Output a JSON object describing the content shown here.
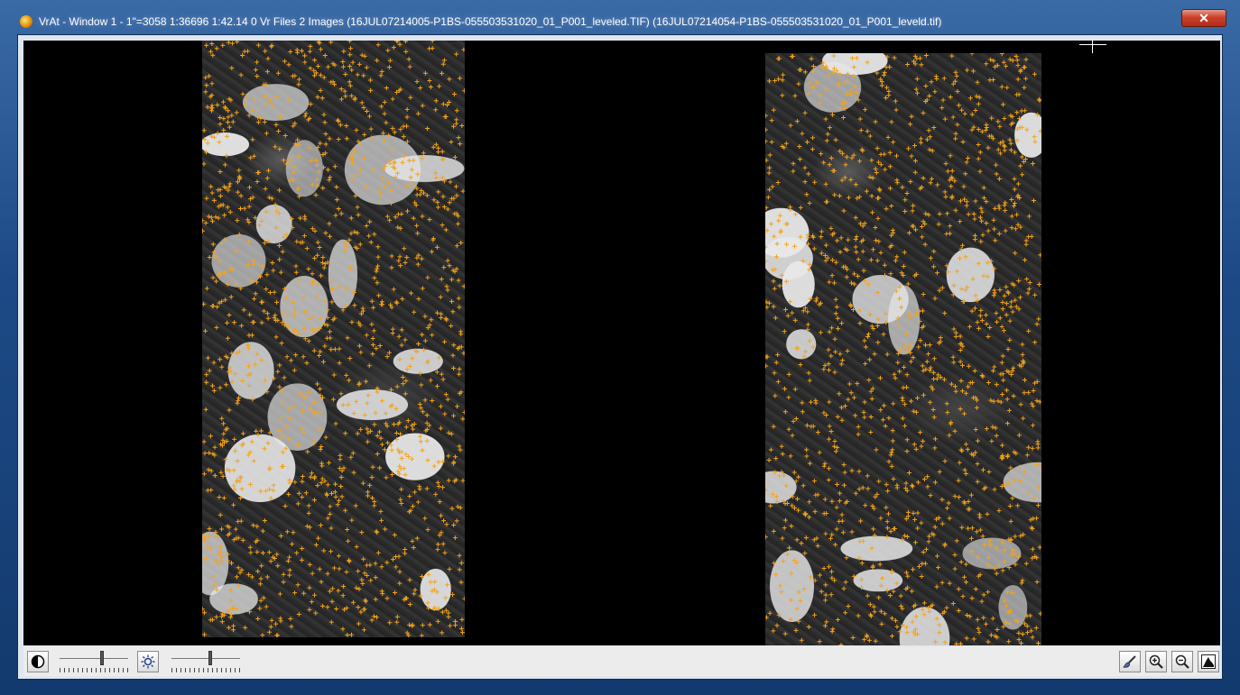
{
  "window": {
    "title": "VrAt - Window 1 - 1\"=3058   1:36696   1:42.14   0 Vr Files   2 Images (16JUL07214005-P1BS-055503531020_01_P001_leveled.TIF) (16JUL07214054-P1BS-055503531020_01_P001_leveld.tif)",
    "close_symbol": "✕",
    "app_icon": "vrat-globe-icon"
  },
  "viewer": {
    "background_color": "#000000",
    "images": [
      {
        "name": "16JUL07214005-P1BS-055503531020_01_P001_leveled.TIF",
        "kind": "panchromatic satellite strip with tie points"
      },
      {
        "name": "16JUL07214054-P1BS-055503531020_01_P001_leveld.tif",
        "kind": "panchromatic satellite strip with tie points"
      }
    ],
    "marker_color": "#f5a31a",
    "marker_symbol": "+"
  },
  "toolbar": {
    "contrast_icon": "contrast-icon",
    "brightness_icon": "brightness-icon",
    "contrast_slider_value": 0.62,
    "brightness_slider_value": 0.57,
    "right_icons": [
      "paint-brush-icon",
      "zoom-in-icon",
      "zoom-out-icon",
      "histogram-icon"
    ]
  }
}
